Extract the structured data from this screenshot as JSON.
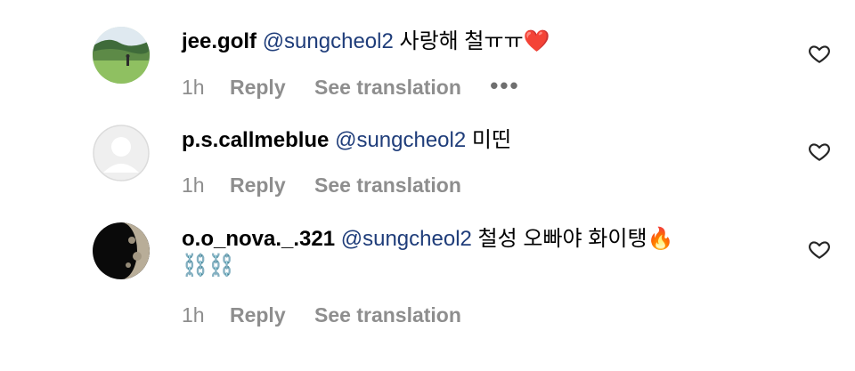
{
  "comments": [
    {
      "username": "jee.golf",
      "mention": "@sungcheol2",
      "text": "사랑해 철ㅠㅠ❤️",
      "time": "1h",
      "reply_label": "Reply",
      "translate_label": "See translation",
      "more_label": "•••",
      "avatar": "golf-course-photo"
    },
    {
      "username": "p.s.callmeblue",
      "mention": "@sungcheol2",
      "text": "미띤",
      "time": "1h",
      "reply_label": "Reply",
      "translate_label": "See translation",
      "avatar": "default-avatar"
    },
    {
      "username": "o.o_nova._.321",
      "mention": "@sungcheol2",
      "text": "철성 오빠야 화이탱🔥",
      "text_line2": "⛓️⛓️",
      "time": "1h",
      "reply_label": "Reply",
      "translate_label": "See translation",
      "avatar": "moon-photo"
    }
  ],
  "icons": {
    "like": "heart-outline-icon"
  },
  "colors": {
    "mention": "#1f3d7a",
    "meta": "#8e8e8e"
  }
}
